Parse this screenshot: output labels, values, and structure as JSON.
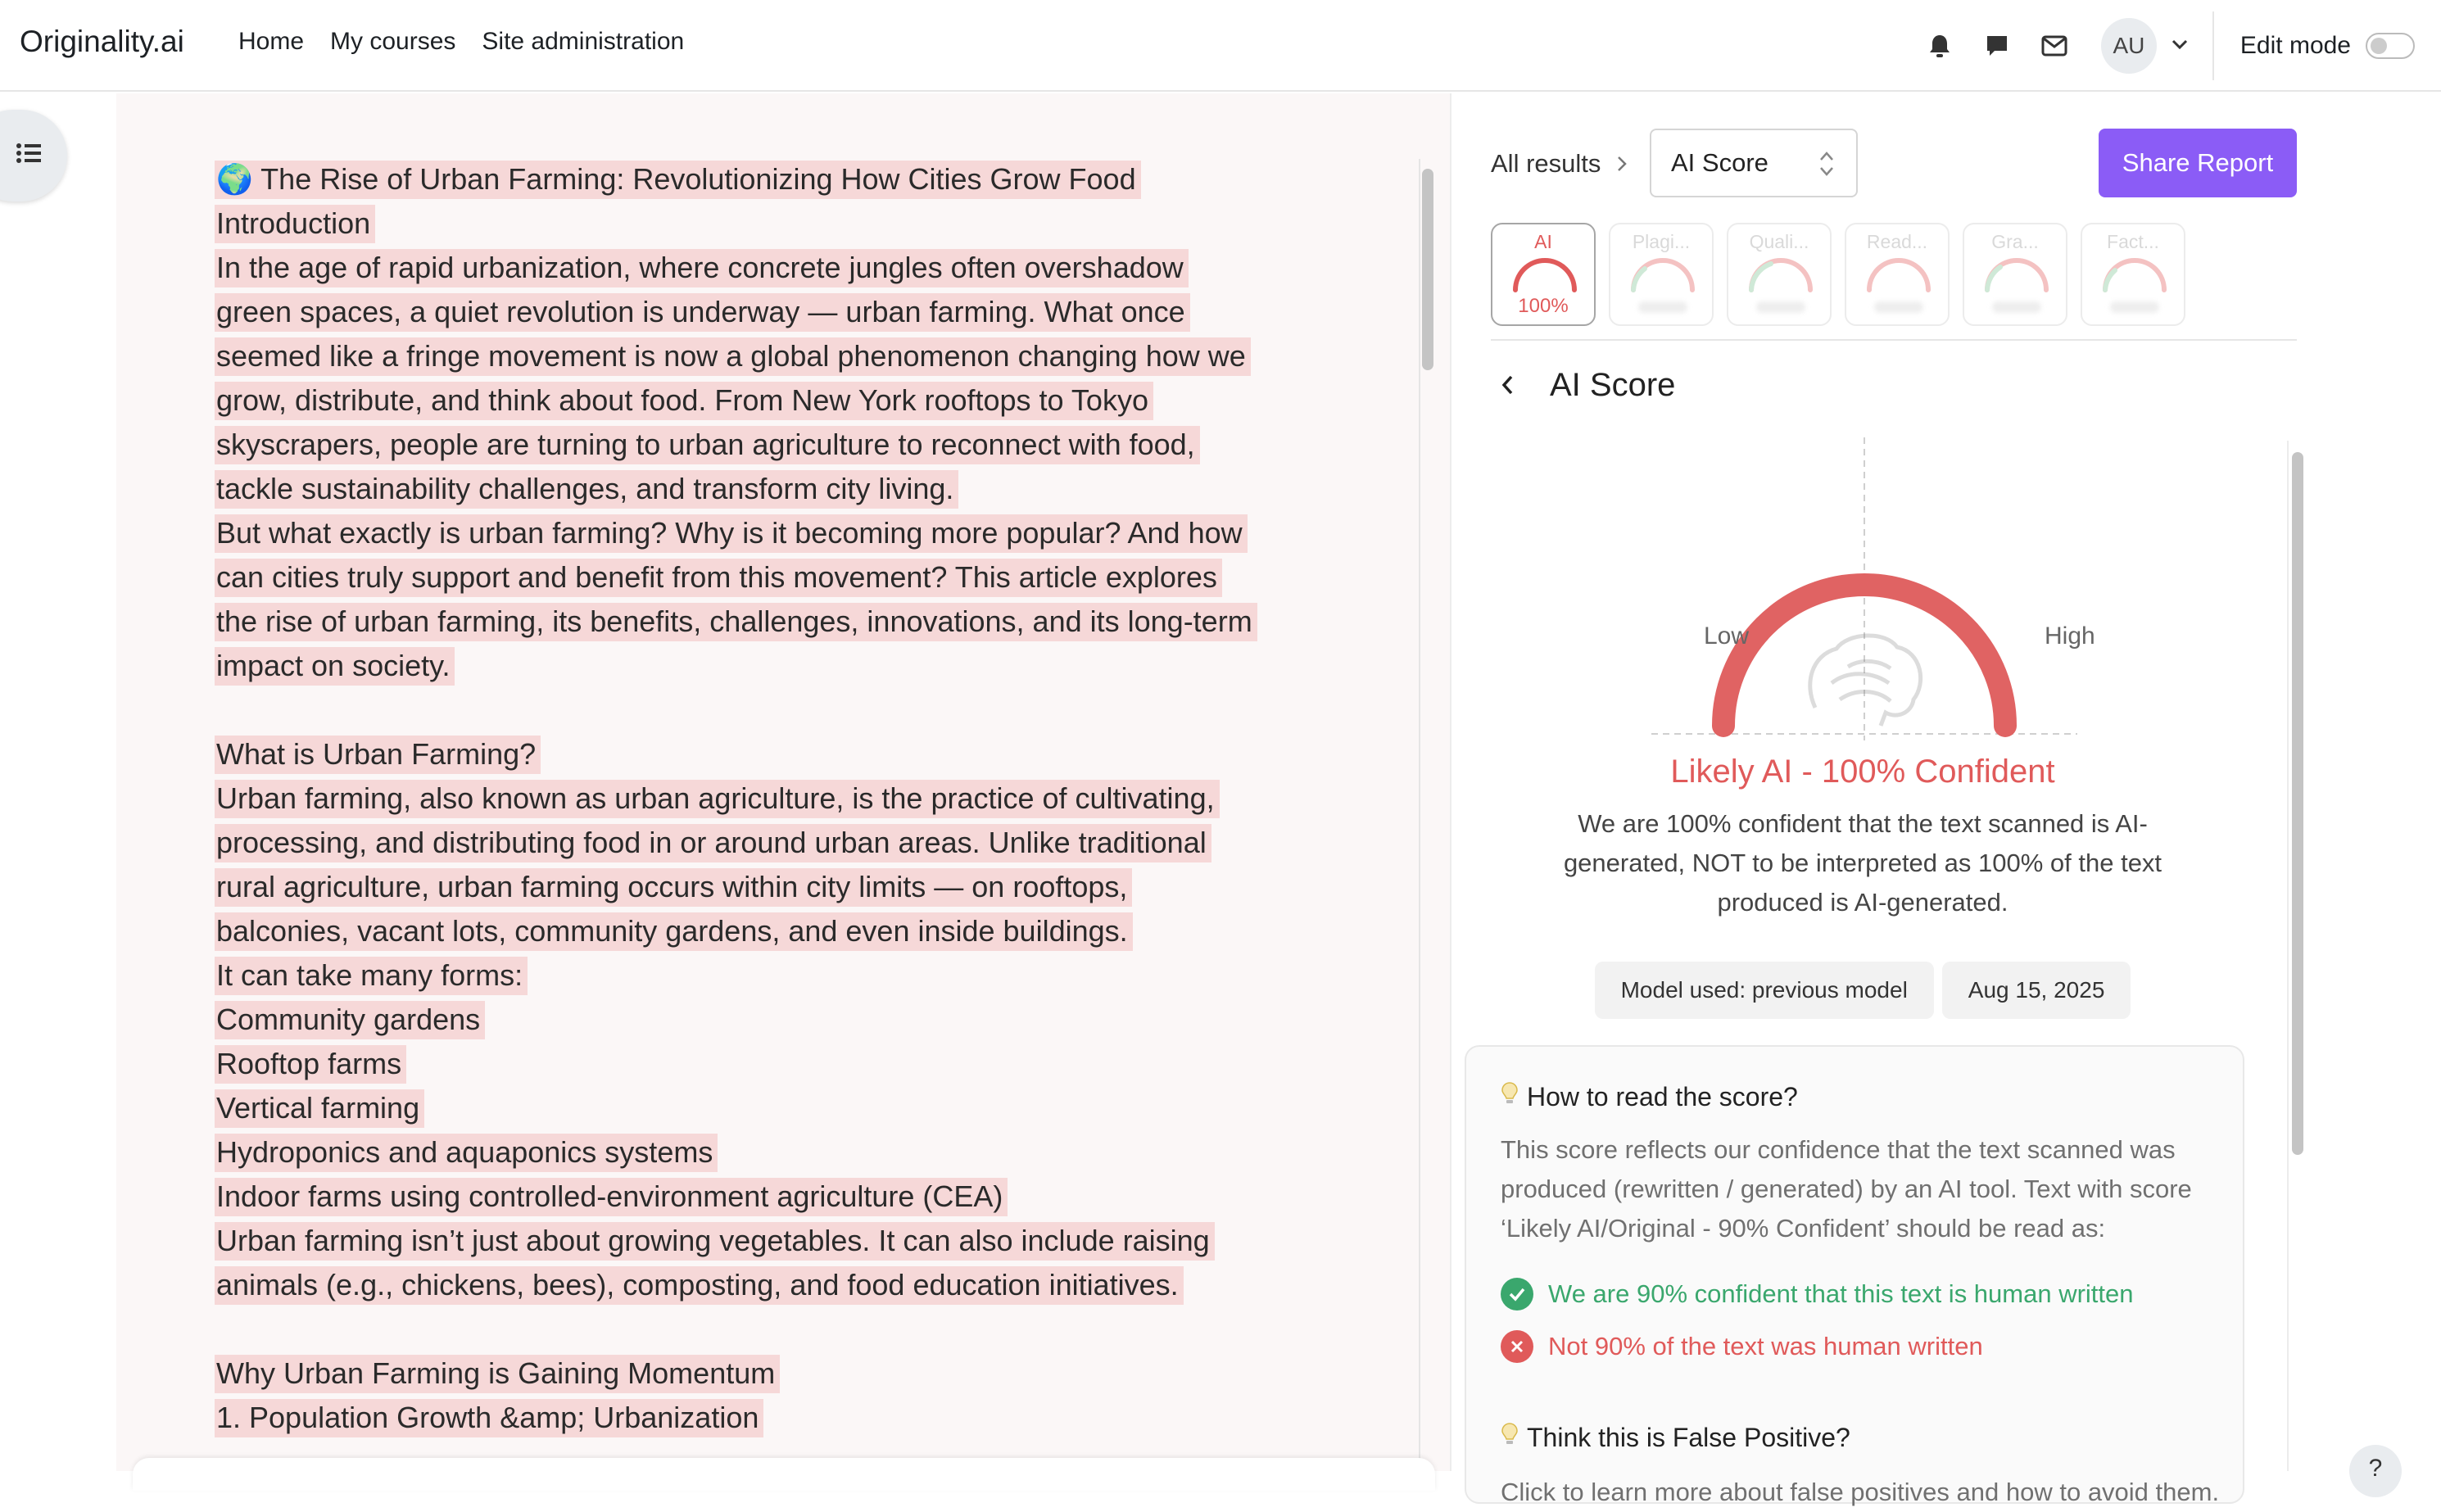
{
  "navbar": {
    "brand": "Originality.ai",
    "links": [
      "Home",
      "My courses",
      "Site administration"
    ],
    "avatar_initials": "AU",
    "edit_mode_label": "Edit mode"
  },
  "document": {
    "lines": [
      "🌍 The Rise of Urban Farming: Revolutionizing How Cities Grow Food",
      "Introduction",
      "In the age of rapid urbanization, where concrete jungles often overshadow",
      "green spaces, a quiet revolution is underway — urban farming. What once",
      "seemed like a fringe movement is now a global phenomenon changing how we",
      "grow, distribute, and think about food. From New York rooftops to Tokyo",
      "skyscrapers, people are turning to urban agriculture to reconnect with food,",
      "tackle sustainability challenges, and transform city living.",
      "But what exactly is urban farming? Why is it becoming more popular? And how",
      "can cities truly support and benefit from this movement? This article explores",
      "the rise of urban farming, its benefits, challenges, innovations, and its long-term",
      "impact on society.",
      "",
      "What is Urban Farming?",
      "Urban farming, also known as urban agriculture, is the practice of cultivating,",
      "processing, and distributing food in or around urban areas. Unlike traditional",
      "rural agriculture, urban farming occurs within city limits — on rooftops,",
      "balconies, vacant lots, community gardens, and even inside buildings.",
      "It can take many forms:",
      "Community gardens",
      "Rooftop farms",
      "Vertical farming",
      "Hydroponics and aquaponics systems",
      "Indoor farms using controlled-environment agriculture (CEA)",
      "Urban farming isn’t just about growing vegetables. It can also include raising",
      "animals (e.g., chickens, bees), composting, and food education initiatives.",
      "",
      "Why Urban Farming is Gaining Momentum",
      "1. Population Growth &amp; Urbanization"
    ]
  },
  "report": {
    "breadcrumb": "All results",
    "select_value": "AI Score",
    "share_label": "Share Report",
    "tabs": [
      {
        "label": "AI",
        "value": "100%"
      },
      {
        "label": "Plagi..."
      },
      {
        "label": "Quali..."
      },
      {
        "label": "Read..."
      },
      {
        "label": "Gra..."
      },
      {
        "label": "Fact..."
      }
    ],
    "section_title": "AI Score",
    "gauge": {
      "low_label": "Low",
      "high_label": "High",
      "score": 1.0
    },
    "verdict": "Likely AI - 100% Confident",
    "verdict_desc": "We are 100% confident that the text scanned is AI-generated, NOT to be interpreted as 100% of the text produced is AI-generated.",
    "model_chip": "Model used: previous model",
    "date_chip": "Aug 15, 2025",
    "info": {
      "how_title": "How to read the score?",
      "how_body": "This score reflects our confidence that the text scanned was produced (rewritten / generated) by an AI tool. Text with score ‘Likely AI/Original - 90% Confident’ should be read as:",
      "correct": "We are 90% confident that this text is human written",
      "incorrect": "Not 90% of the text was human written",
      "fp_title": "Think this is False Positive?",
      "fp_body": "Click to learn more about false positives and how to avoid them."
    }
  },
  "help_label": "?",
  "colors": {
    "accent": "#8b5cf6",
    "ai_red": "#e05a5a",
    "highlight": "#f6d8d8",
    "success": "#3aa76d"
  }
}
